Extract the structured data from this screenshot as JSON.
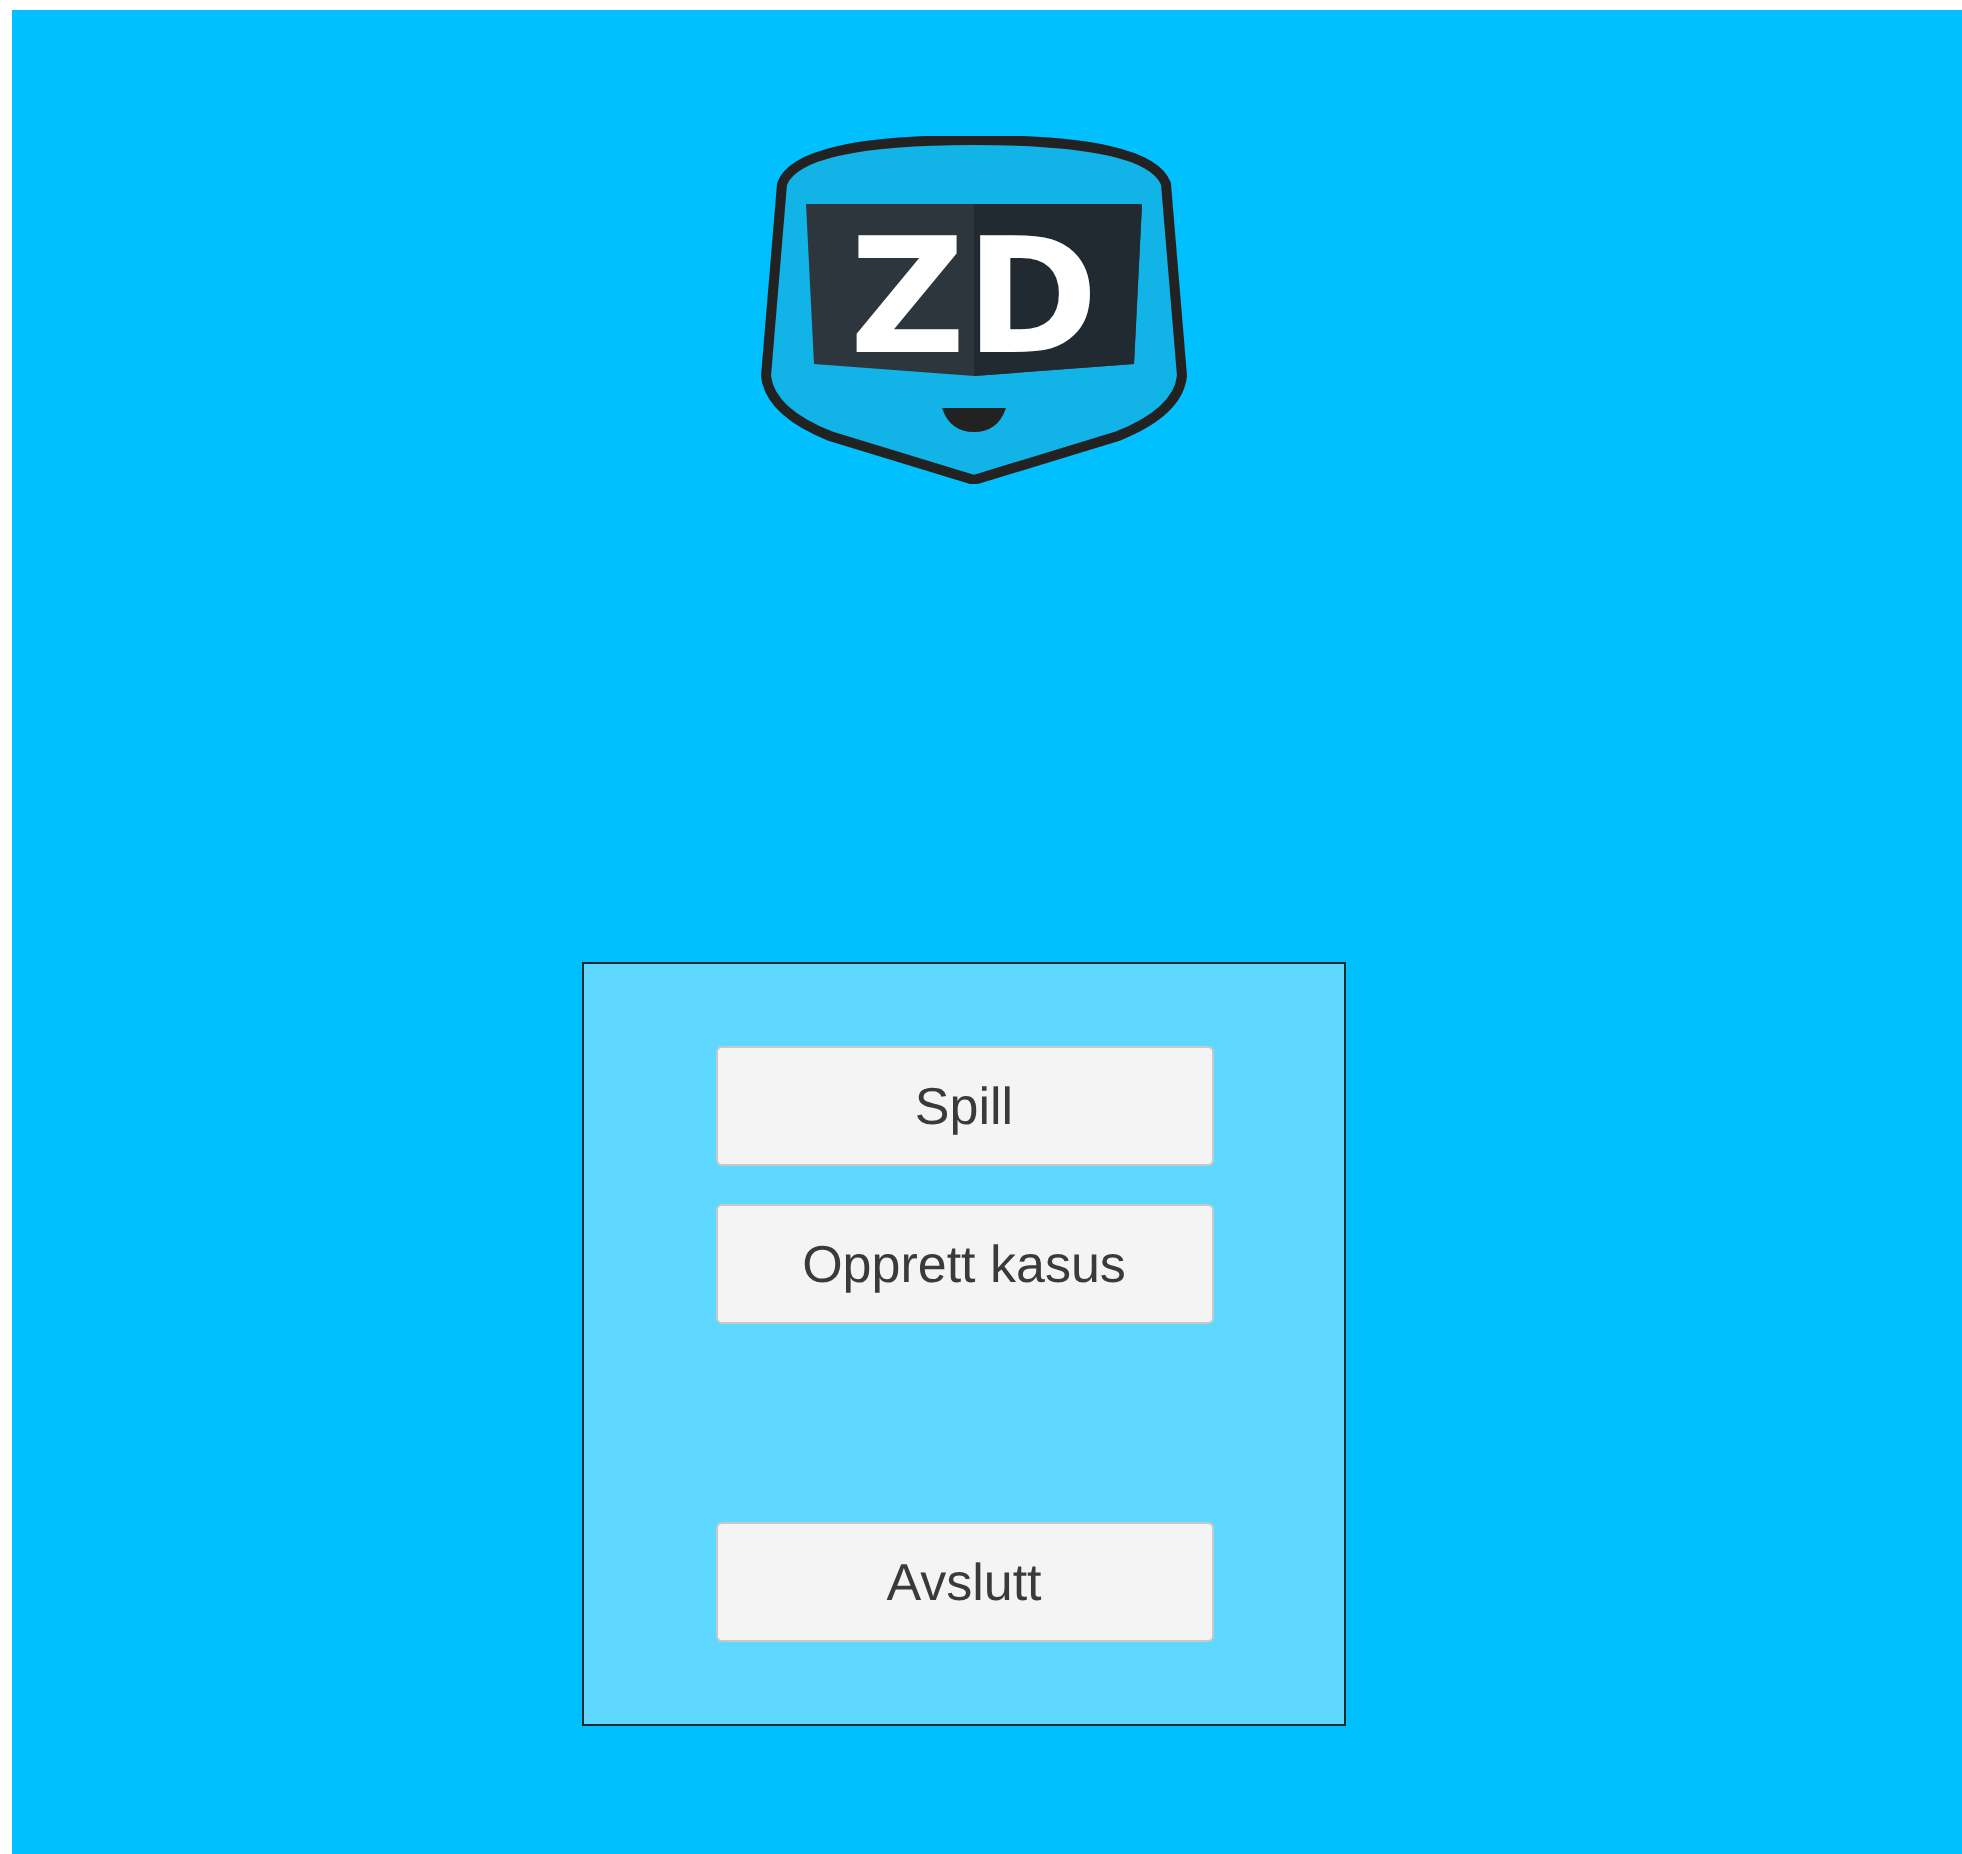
{
  "logo": {
    "text": "ZD"
  },
  "menu": {
    "buttons": [
      {
        "label": "Spill"
      },
      {
        "label": "Opprett kasus"
      }
    ],
    "exit_button": {
      "label": "Avslutt"
    }
  }
}
